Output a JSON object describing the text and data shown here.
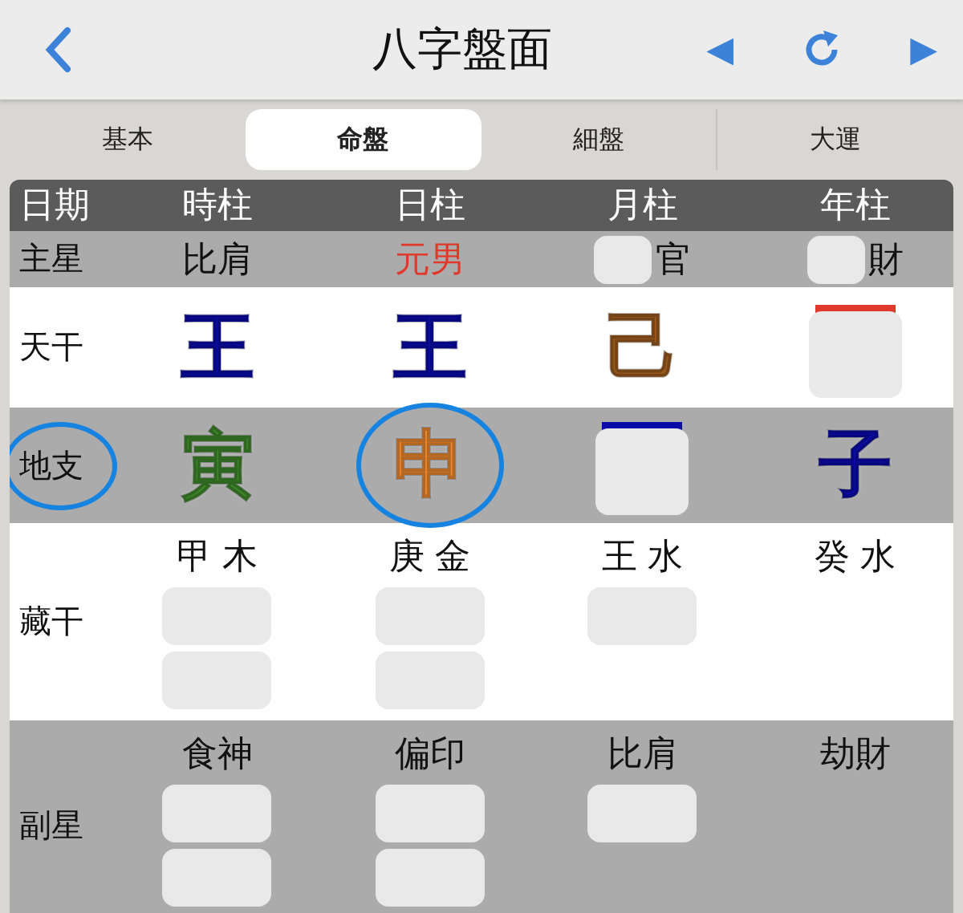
{
  "nav": {
    "title": "八字盤面",
    "prev": "◀",
    "next": "▶"
  },
  "tabs": [
    {
      "label": "基本",
      "selected": false
    },
    {
      "label": "命盤",
      "selected": true
    },
    {
      "label": "細盤",
      "selected": false
    },
    {
      "label": "大運",
      "selected": false
    }
  ],
  "table": {
    "rows": [
      {
        "kind": "header",
        "label": "日期",
        "cells": [
          {
            "text": "時柱"
          },
          {
            "text": "日柱"
          },
          {
            "text": "月柱"
          },
          {
            "text": "年柱"
          }
        ]
      },
      {
        "kind": "stars",
        "label": "主星",
        "cells": [
          {
            "text": "比肩",
            "redacted": false
          },
          {
            "text": "元男",
            "redacted": false,
            "color": "#e0392b"
          },
          {
            "text": "官",
            "redacted": true
          },
          {
            "text": "財",
            "redacted": true
          }
        ]
      },
      {
        "kind": "stems",
        "label": "天干",
        "cells": [
          {
            "text": "王",
            "color": "#0b0ba8",
            "redacted": false
          },
          {
            "text": "王",
            "color": "#0b0ba8",
            "redacted": false
          },
          {
            "text": "己",
            "color": "#9b5a1e",
            "redacted": false
          },
          {
            "color": "#e0392b",
            "redacted": true
          }
        ]
      },
      {
        "kind": "branches",
        "label": "地支",
        "label_circled": true,
        "cells": [
          {
            "text": "寅",
            "color": "#3f8a2b",
            "circled": false,
            "redacted": false
          },
          {
            "text": "申",
            "color": "#f0892f",
            "circled": true,
            "redacted": false
          },
          {
            "color": "#0b0ba8",
            "circled": false,
            "redacted": true
          },
          {
            "text": "子",
            "color": "#0b0ba8",
            "circled": false,
            "redacted": false
          }
        ]
      },
      {
        "kind": "hidden",
        "label": "藏干",
        "cells": [
          {
            "text": "甲 木",
            "notes": [
              {
                "kind": "redacted"
              },
              {
                "kind": "redacted"
              }
            ]
          },
          {
            "text": "庚 金",
            "notes": [
              {
                "kind": "redacted"
              },
              {
                "kind": "redacted"
              }
            ]
          },
          {
            "text": "王 水",
            "notes": [
              {
                "kind": "redacted"
              }
            ]
          },
          {
            "text": "癸 水"
          }
        ]
      },
      {
        "kind": "sub",
        "label": "副星",
        "cells": [
          {
            "text": "食神",
            "notes": [
              {
                "kind": "redacted"
              },
              {
                "kind": "redacted"
              }
            ]
          },
          {
            "text": "偏印",
            "notes": [
              {
                "kind": "redacted"
              },
              {
                "kind": "redacted"
              }
            ]
          },
          {
            "text": "比肩",
            "notes": [
              {
                "kind": "redacted"
              }
            ]
          },
          {
            "text": "劫財"
          }
        ]
      }
    ]
  }
}
